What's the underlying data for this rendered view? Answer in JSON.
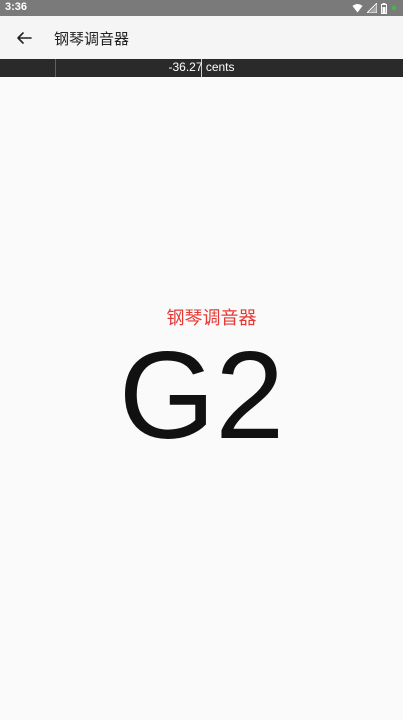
{
  "status_bar": {
    "time": "3:36"
  },
  "app_bar": {
    "title": "钢琴调音器"
  },
  "tuner": {
    "cents_text": "-36.27 cents",
    "instrument_label": "钢琴调音器",
    "note": "G2"
  },
  "colors": {
    "needle": "#d32f2f",
    "instrument_label": "#e53935",
    "cents_bar": "#2a2a2a"
  }
}
